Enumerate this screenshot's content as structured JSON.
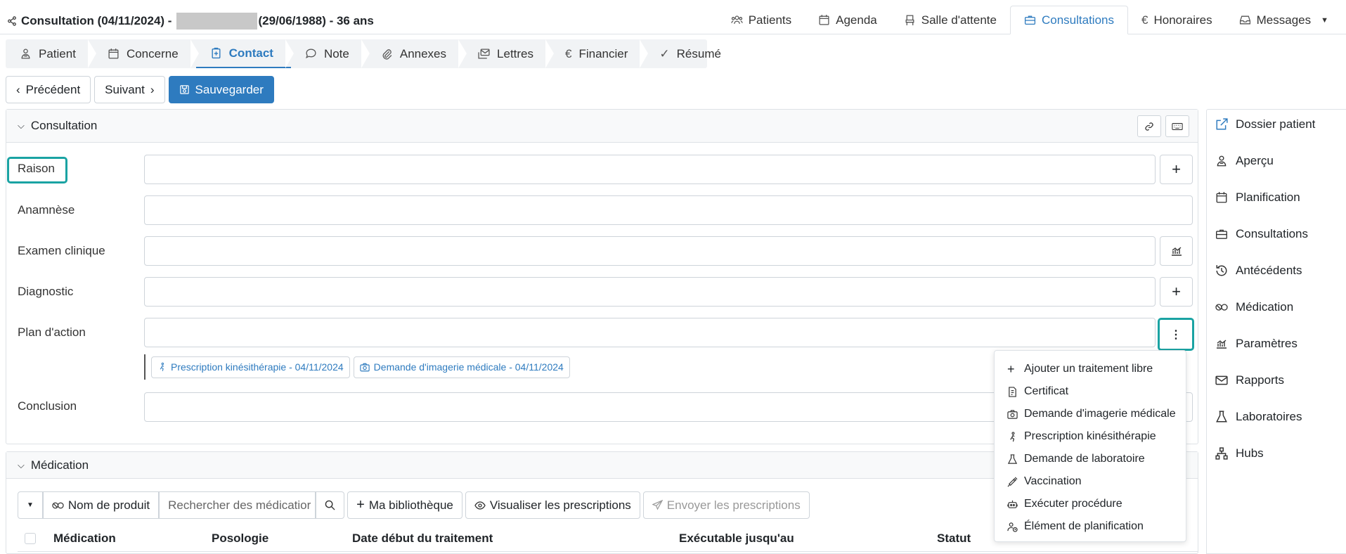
{
  "header": {
    "title_prefix": "Consultation (04/11/2024) -",
    "title_suffix": "(29/06/1988) - 36 ans",
    "nav": [
      {
        "label": "Patients",
        "icon": "users-icon"
      },
      {
        "label": "Agenda",
        "icon": "calendar-icon"
      },
      {
        "label": "Salle d'attente",
        "icon": "chair-icon"
      },
      {
        "label": "Consultations",
        "icon": "briefcase-icon",
        "active": true
      },
      {
        "label": "Honoraires",
        "icon": "euro-icon"
      },
      {
        "label": "Messages",
        "icon": "inbox-icon"
      }
    ]
  },
  "steps": [
    {
      "label": "Patient"
    },
    {
      "label": "Concerne"
    },
    {
      "label": "Contact",
      "active": true
    },
    {
      "label": "Note"
    },
    {
      "label": "Annexes"
    },
    {
      "label": "Lettres"
    },
    {
      "label": "Financier"
    },
    {
      "label": "Résumé"
    }
  ],
  "actions": {
    "prev": "Précédent",
    "next": "Suivant",
    "save": "Sauvegarder"
  },
  "consultation": {
    "title": "Consultation",
    "fields": {
      "raison": "Raison",
      "anamnese": "Anamnèse",
      "examen": "Examen clinique",
      "diagnostic": "Diagnostic",
      "plan": "Plan d'action",
      "conclusion": "Conclusion"
    },
    "chips": [
      "Prescription kinésithérapie - 04/11/2024",
      "Demande d'imagerie médicale - 04/11/2024"
    ]
  },
  "dropdown": [
    "Ajouter un traitement libre",
    "Certificat",
    "Demande d'imagerie médicale",
    "Prescription kinésithérapie",
    "Demande de laboratoire",
    "Vaccination",
    "Exécuter procédure",
    "Élément de planification"
  ],
  "medication": {
    "title": "Médication",
    "product_label": "Nom de produit",
    "search_placeholder": "Rechercher des médicatior",
    "library": "Ma bibliothèque",
    "view": "Visualiser les prescriptions",
    "send": "Envoyer les prescriptions",
    "columns": [
      "Médication",
      "Posologie",
      "Date début du traitement",
      "Exécutable jusqu'au",
      "Statut"
    ]
  },
  "sidebar": [
    "Dossier patient",
    "Aperçu",
    "Planification",
    "Consultations",
    "Antécédents",
    "Médication",
    "Paramètres",
    "Rapports",
    "Laboratoires",
    "Hubs"
  ],
  "colors": {
    "accent": "#2e7bbf",
    "highlight": "#1aa3a3"
  }
}
